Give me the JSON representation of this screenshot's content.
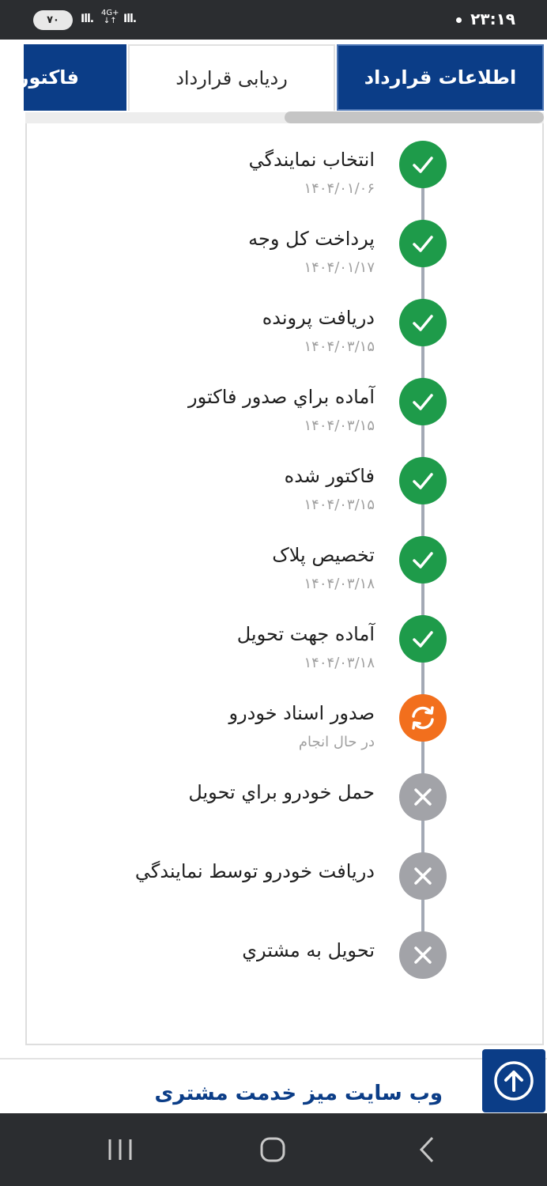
{
  "status_bar": {
    "time": "۲۳:۱۹",
    "battery": "۷۰",
    "network_label": "4G+"
  },
  "tabs": [
    {
      "label": "اطلاعات قرارداد",
      "active": true
    },
    {
      "label": "ردیابی قرارداد",
      "active": false
    },
    {
      "label": "فاکتور",
      "active": true
    }
  ],
  "steps": [
    {
      "title": "انتخاب نمايندگي",
      "sub": "۱۴۰۴/۰۱/۰۶",
      "status": "done",
      "icon": "check-icon"
    },
    {
      "title": "پرداخت کل وجه",
      "sub": "۱۴۰۴/۰۱/۱۷",
      "status": "done",
      "icon": "check-icon"
    },
    {
      "title": "دریافت پرونده",
      "sub": "۱۴۰۴/۰۳/۱۵",
      "status": "done",
      "icon": "check-icon"
    },
    {
      "title": "آماده براي صدور فاکتور",
      "sub": "۱۴۰۴/۰۳/۱۵",
      "status": "done",
      "icon": "check-icon"
    },
    {
      "title": "فاکتور شده",
      "sub": "۱۴۰۴/۰۳/۱۵",
      "status": "done",
      "icon": "check-icon"
    },
    {
      "title": "تخصیص پلاک",
      "sub": "۱۴۰۴/۰۳/۱۸",
      "status": "done",
      "icon": "check-icon"
    },
    {
      "title": "آماده جهت تحویل",
      "sub": "۱۴۰۴/۰۳/۱۸",
      "status": "done",
      "icon": "check-icon"
    },
    {
      "title": "صدور اسناد خودرو",
      "sub": "در حال انجام",
      "status": "progress",
      "icon": "refresh-icon"
    },
    {
      "title": "حمل خودرو براي تحويل",
      "sub": "",
      "status": "pending",
      "icon": "close-icon"
    },
    {
      "title": "دریافت خودرو توسط نمایندگي",
      "sub": "",
      "status": "pending",
      "icon": "close-icon"
    },
    {
      "title": "تحویل به مشتري",
      "sub": "",
      "status": "pending",
      "icon": "close-icon"
    }
  ],
  "footer": {
    "title": "وب سایت میز خدمت مشتری"
  },
  "colors": {
    "primary": "#0b3d87",
    "done": "#1e9b4a",
    "progress": "#f26f1d",
    "pending": "#a2a3a8"
  }
}
